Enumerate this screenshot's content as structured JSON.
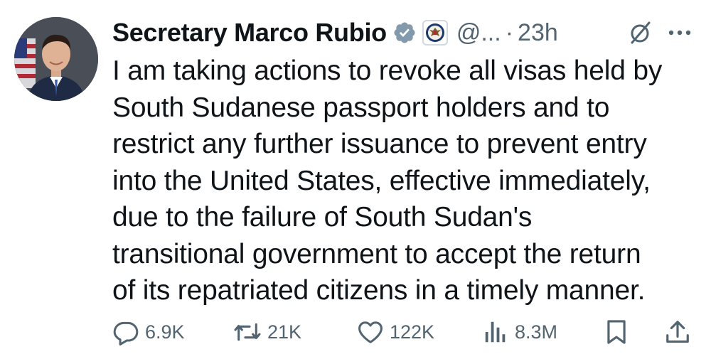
{
  "author": {
    "display_name": "Secretary Marco Rubio",
    "handle": "@...",
    "separator": "·",
    "time": "23h",
    "verified_icon": "verified-badge-icon",
    "affiliate_icon": "state-department-seal-icon",
    "avatar": "avatar"
  },
  "tweet": {
    "lines": [
      "I am taking actions to revoke all visas held by",
      "South Sudanese passport holders and to",
      "restrict any further issuance to prevent entry",
      "into the United States, effective immediately,",
      "due to the failure of South Sudan's",
      "transitional government to accept the return",
      "of its repatriated citizens in a timely manner."
    ]
  },
  "actions": {
    "replies": "6.9K",
    "reposts": "21K",
    "likes": "122K",
    "views": "8.3M"
  },
  "colors": {
    "text_primary": "#0f1419",
    "text_secondary": "#536471",
    "verified": "#829aab"
  }
}
